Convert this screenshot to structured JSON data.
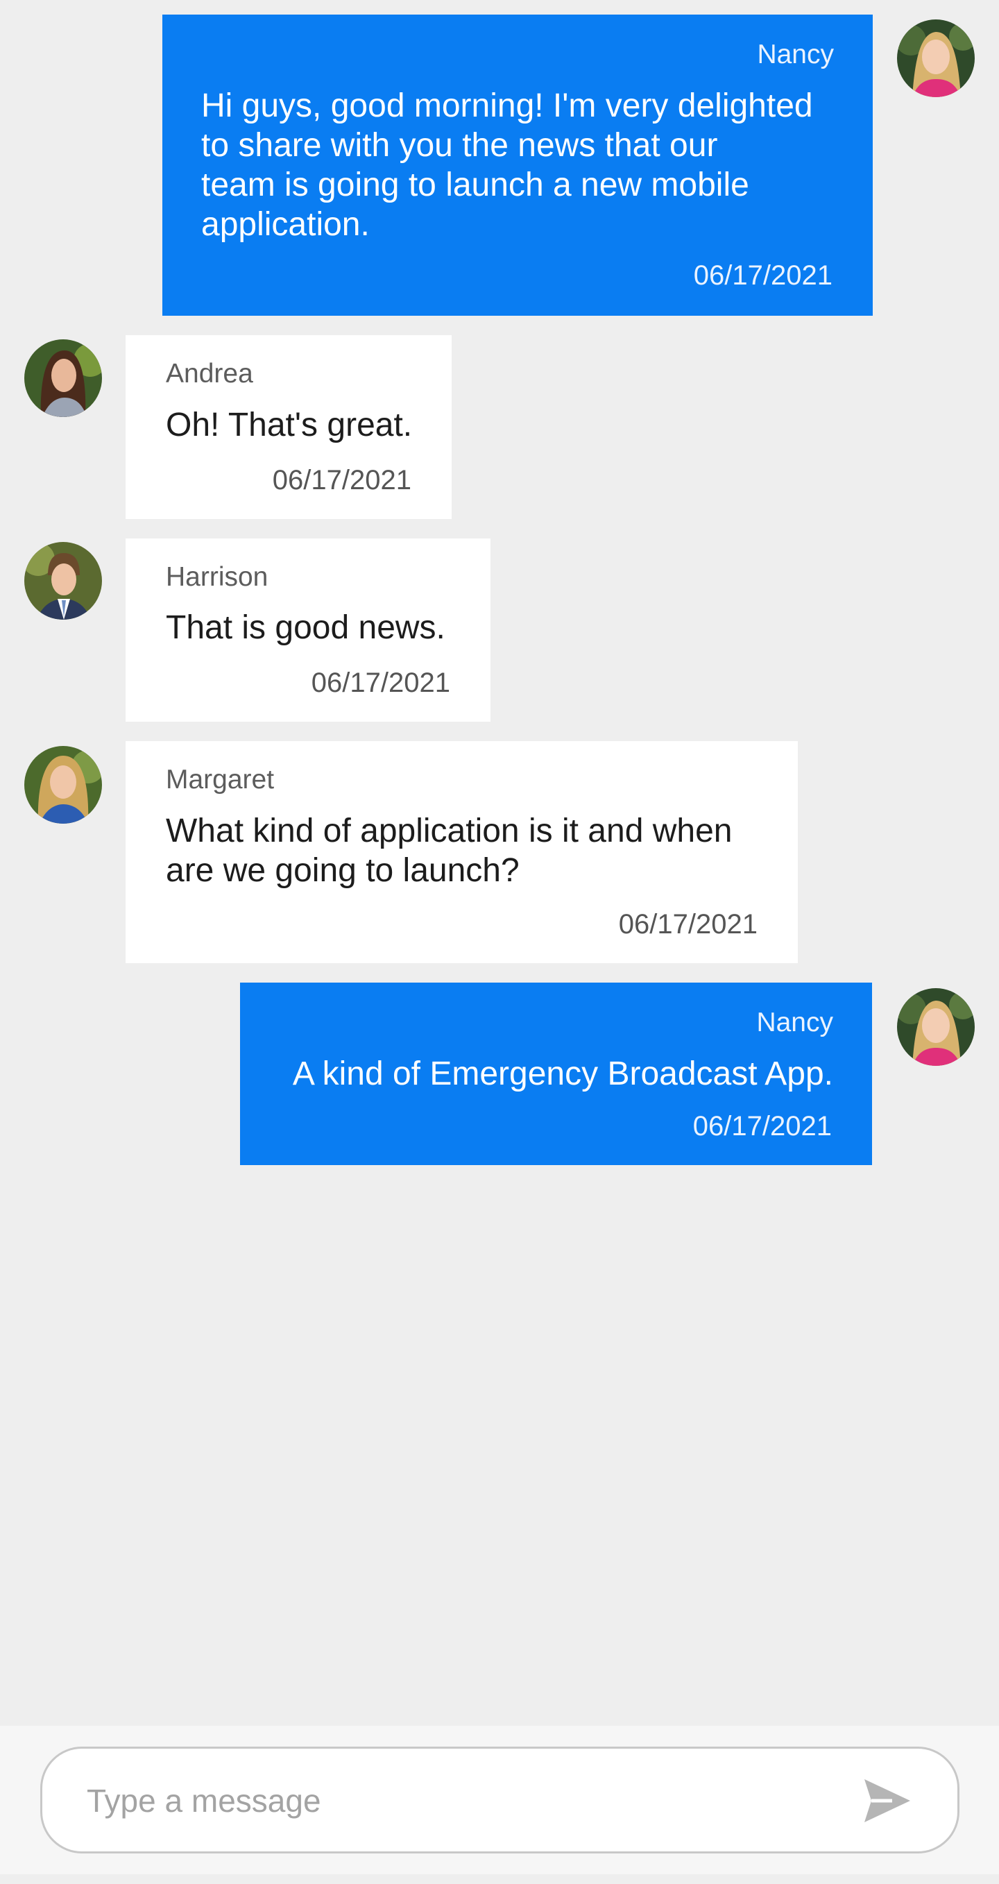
{
  "messages": [
    {
      "author": "Nancy",
      "text": "Hi guys, good morning! I'm very delighted\nto share with you the news that our\nteam is going to launch a new mobile\napplication.",
      "timestamp": "06/17/2021",
      "direction": "outgoing",
      "avatar_icon": "nancy-avatar-icon"
    },
    {
      "author": "Andrea",
      "text": "Oh! That's great.",
      "timestamp": "06/17/2021",
      "direction": "incoming",
      "avatar_icon": "andrea-avatar-icon"
    },
    {
      "author": "Harrison",
      "text": "That is good news.",
      "timestamp": "06/17/2021",
      "direction": "incoming",
      "avatar_icon": "harrison-avatar-icon"
    },
    {
      "author": "Margaret",
      "text": "What kind of application is it and when\nare we going to launch?",
      "timestamp": "06/17/2021",
      "direction": "incoming",
      "avatar_icon": "margaret-avatar-icon"
    },
    {
      "author": "Nancy",
      "text": "A kind of Emergency Broadcast App.",
      "timestamp": "06/17/2021",
      "direction": "outgoing",
      "avatar_icon": "nancy-avatar-icon"
    }
  ],
  "composer": {
    "placeholder": "Type a message",
    "value": "",
    "send_icon": "send-icon"
  },
  "colors": {
    "outgoing_bubble": "#0a7df2",
    "incoming_bubble": "#ffffff",
    "background": "#eeeeee",
    "composer_bar": "#f6f6f6"
  }
}
